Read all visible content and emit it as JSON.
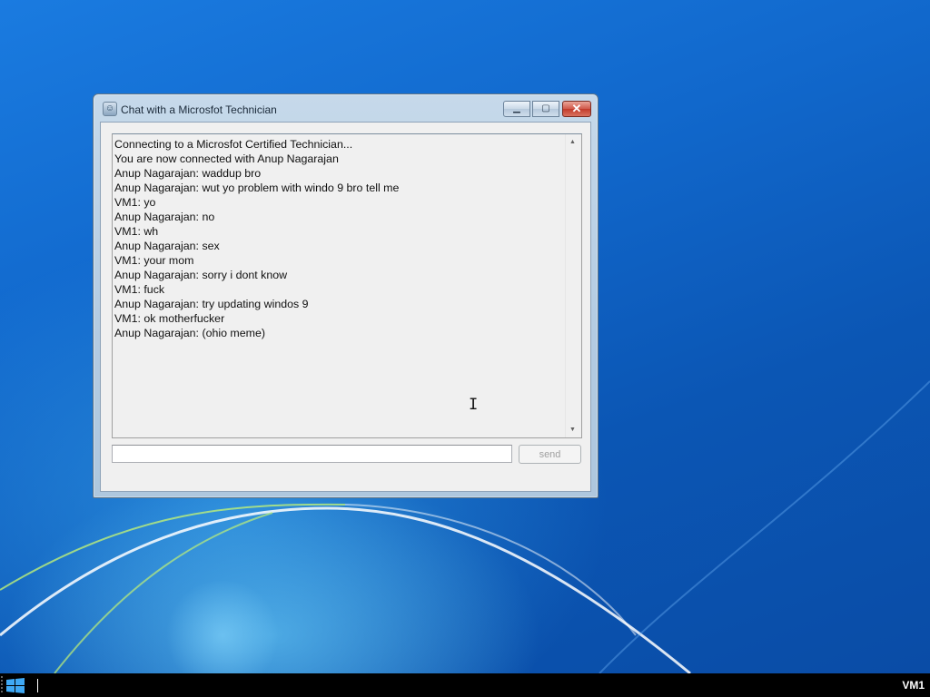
{
  "window": {
    "title": "Chat with a Microsfot Technician",
    "minimize_glyph": "▁",
    "maximize_glyph": "▢",
    "close_glyph": "✕"
  },
  "chat": {
    "messages": [
      "Connecting to a Microsfot Certified Technician...",
      "You are now connected with Anup Nagarajan",
      "Anup Nagarajan: waddup bro",
      "Anup Nagarajan: wut yo problem with windo 9 bro tell me",
      "VM1: yo",
      "Anup Nagarajan: no",
      "VM1: wh",
      "Anup Nagarajan: sex",
      "VM1: your mom",
      "Anup Nagarajan: sorry i dont know",
      "VM1: fuck",
      "Anup Nagarajan: try updating windos 9",
      "VM1: ok motherfucker",
      "Anup Nagarajan: (ohio meme)"
    ],
    "input_value": "",
    "send_label": "send"
  },
  "taskbar": {
    "machine_label": "VM1"
  },
  "icons": {
    "start": "windows-logo-icon",
    "app": "chat-app-icon",
    "cursor": "text-ibeam-cursor"
  },
  "colors": {
    "desktop": "#1168cc",
    "taskbar": "#000000",
    "close_button": "#c23b2b"
  }
}
